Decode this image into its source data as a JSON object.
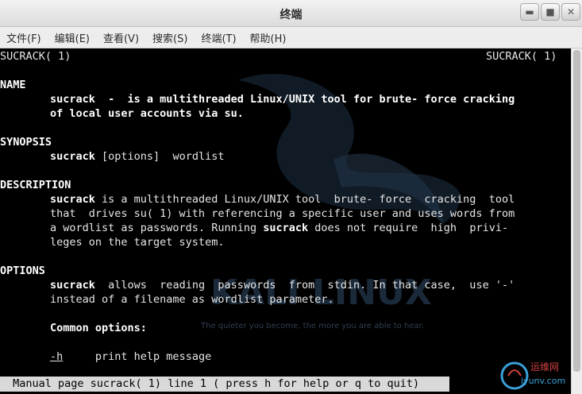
{
  "window": {
    "title": "终端",
    "controls": [
      "minimize",
      "maximize",
      "close"
    ]
  },
  "menu": [
    "文件(F)",
    "编辑(E)",
    "查看(V)",
    "搜索(S)",
    "终端(T)",
    "帮助(H)"
  ],
  "man": {
    "header_left": "SUCRACK( 1)",
    "header_right": "SUCRACK( 1)",
    "name_heading": "NAME",
    "name_cmd": "sucrack",
    "name_rest1": "  -  is a multithreaded Linux/UNIX tool for brute- force cracking",
    "name_rest2": "of local user accounts via su.",
    "synopsis_heading": "SYNOPSIS",
    "synopsis_cmd": "sucrack",
    "synopsis_rest": " [options]  wordlist",
    "description_heading": "DESCRIPTION",
    "desc_cmd": "sucrack",
    "desc_l1": " is a multithreaded Linux/UNIX tool  brute- force  cracking  tool",
    "desc_l2": "that  drives su( 1) with referencing a specific user and uses words from",
    "desc_l3a": "a wordlist as passwords. Running ",
    "desc_l3cmd": "sucrack",
    "desc_l3b": " does not require  high  privi-",
    "desc_l4": "leges on the target system.",
    "options_heading": "OPTIONS",
    "opt_cmd": "sucrack",
    "opt_l1": "  allows  reading  passwords  from  stdin. In that case,  use '-'",
    "opt_l2": "instead of a filename as wordlist parameter.",
    "common_heading": "Common options:",
    "opt_h_flag": "-h",
    "opt_h_desc": "     print help message"
  },
  "status": " Manual page sucrack( 1) line 1 ( press h for help or q to quit)",
  "watermark": {
    "brand": "KALI LINUX",
    "tagline": "The quieter you become, the more you are able to hear.",
    "corner_cn": "运维网",
    "corner_url": "iyunv.com"
  }
}
